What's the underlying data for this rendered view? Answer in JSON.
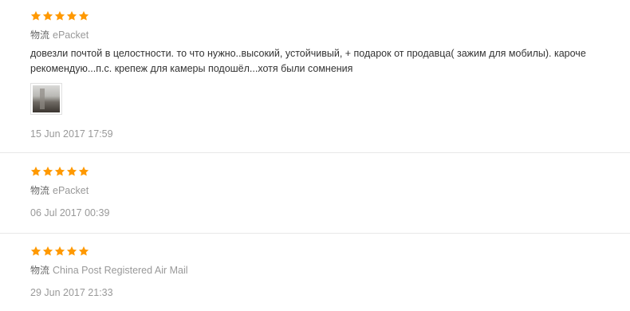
{
  "colors": {
    "star": "#f90",
    "divider": "#e8e8e8",
    "text": "#333333",
    "muted": "#999999"
  },
  "reviews": [
    {
      "rating": 5,
      "shipping_key": "物流",
      "shipping_value": "ePacket",
      "comment_line1": "довезли почтой в целостности. то что нужно..высокий, устойчивый, + подарок от продавца( зажим для мобилы). кароче",
      "comment_line2": "рекомендую...п.с. крепеж для камеры подошёл...хотя были сомнения",
      "photo": "review-photo-thumbnail",
      "date": "15 Jun 2017 17:59"
    },
    {
      "rating": 5,
      "shipping_key": "物流",
      "shipping_value": "ePacket",
      "date": "06 Jul 2017 00:39"
    },
    {
      "rating": 5,
      "shipping_key": "物流",
      "shipping_value": "China Post Registered Air Mail",
      "date": "29 Jun 2017 21:33"
    }
  ]
}
